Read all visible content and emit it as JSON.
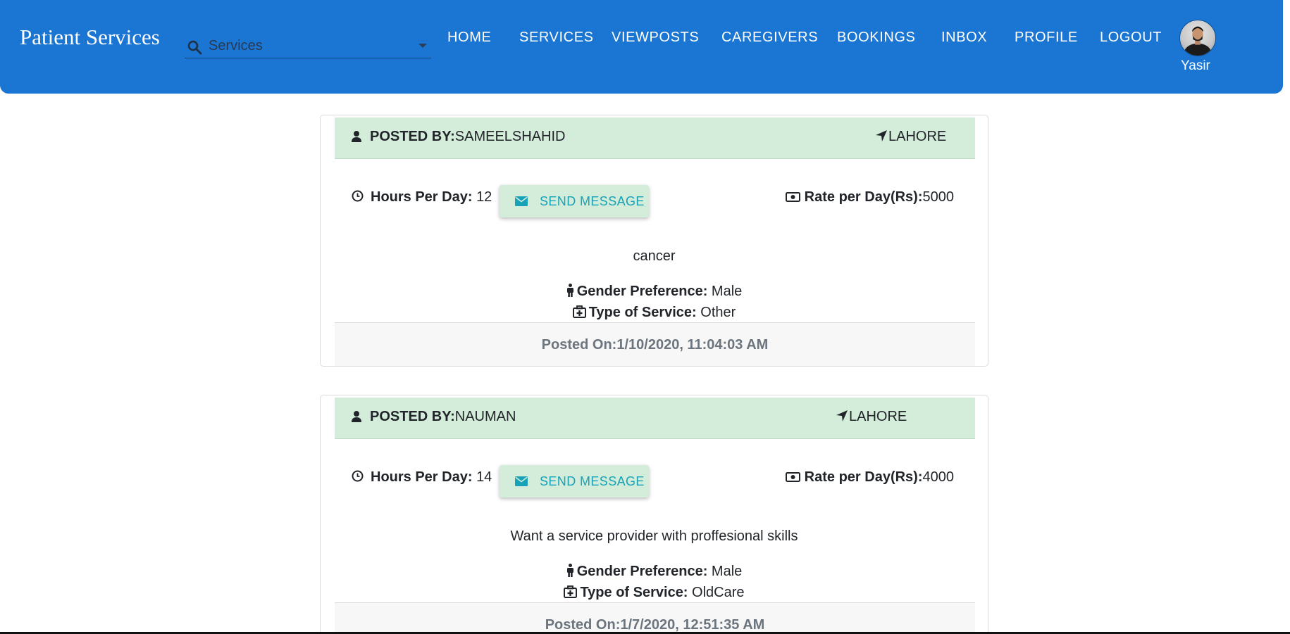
{
  "navbar": {
    "brand": "Patient Services",
    "search": {
      "placeholder": "Services",
      "icon": "search-icon"
    },
    "links": [
      {
        "label": "HOME"
      },
      {
        "label": "SERVICES"
      },
      {
        "label": "VIEWPOSTS"
      },
      {
        "label": "CAREGIVERS"
      },
      {
        "label": "BOOKINGS"
      },
      {
        "label": "INBOX"
      },
      {
        "label": "PROFILE"
      },
      {
        "label": "LOGOUT"
      }
    ],
    "user": {
      "name": "Yasir",
      "avatar": "avatar-photo"
    }
  },
  "labels": {
    "posted_by": "POSTED BY:",
    "hours_per_day": "Hours Per Day:",
    "send_message": "SEND MESSAGE",
    "rate_per_day": "Rate per Day(Rs):",
    "gender_preference": "Gender Preference:",
    "type_of_service": "Type of Service:",
    "posted_on": "Posted On:"
  },
  "posts": [
    {
      "posted_by": "SAMEELSHAHID",
      "location": "LAHORE",
      "hours": "12",
      "rate": "5000",
      "description": "cancer",
      "gender": "Male",
      "service_type": "Other",
      "posted_on": "1/10/2020, 11:04:03 AM"
    },
    {
      "posted_by": "NAUMAN",
      "location": "LAHORE",
      "hours": "14",
      "rate": "4000",
      "description": "Want a service provider with proffesional skills",
      "gender": "Male",
      "service_type": "OldCare",
      "posted_on": "1/7/2020, 12:51:35 AM"
    }
  ],
  "colors": {
    "navbar": "#1a76d2",
    "card_header": "#d4edda",
    "button_text": "#17a2b8",
    "footer_text": "#6c757d"
  }
}
